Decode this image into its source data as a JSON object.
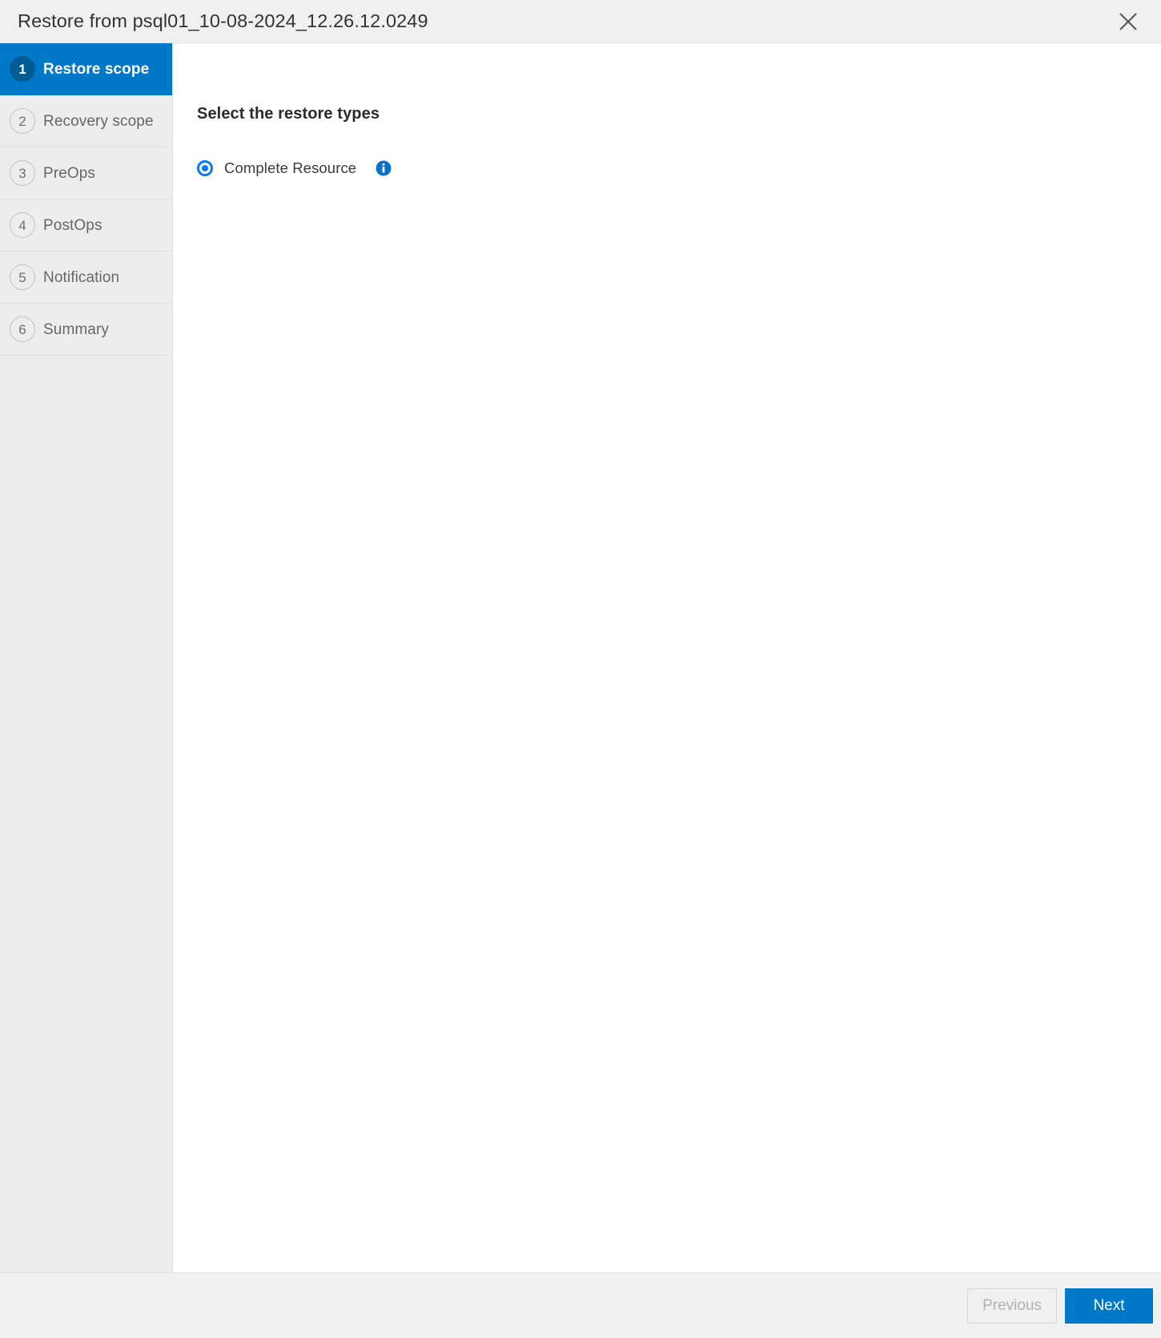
{
  "header": {
    "title": "Restore from psql01_10-08-2024_12.26.12.0249",
    "close_icon": "close-icon",
    "background": "#f0f0f0"
  },
  "sidebar": {
    "active_color": "#0078c8",
    "badge_active_color": "#005b94",
    "items": [
      {
        "number": "1",
        "label": "Restore scope",
        "active": true
      },
      {
        "number": "2",
        "label": "Recovery scope",
        "active": false
      },
      {
        "number": "3",
        "label": "PreOps",
        "active": false
      },
      {
        "number": "4",
        "label": "PostOps",
        "active": false
      },
      {
        "number": "5",
        "label": "Notification",
        "active": false
      },
      {
        "number": "6",
        "label": "Summary",
        "active": false
      }
    ]
  },
  "main": {
    "heading": "Select the restore types",
    "options": [
      {
        "label": "Complete Resource",
        "selected": true,
        "info_icon": "info-icon",
        "radio_color": "#0b7cf0"
      }
    ]
  },
  "footer": {
    "previous_label": "Previous",
    "next_label": "Next",
    "previous_disabled": true,
    "next_color": "#0078c8"
  }
}
